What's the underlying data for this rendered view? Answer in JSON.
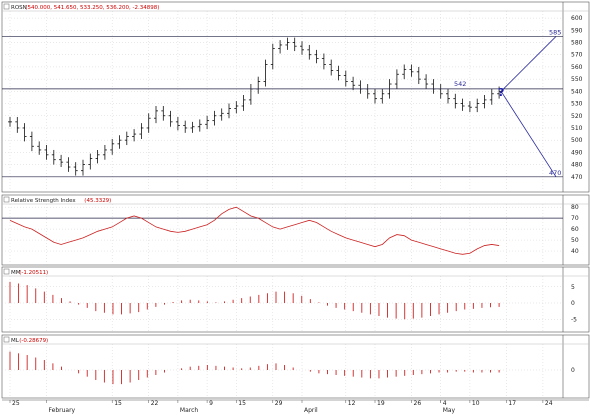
{
  "colors": {
    "price_bar": "#111111",
    "level_line": "#222244",
    "trend_line": "#2a2aa0",
    "indicator": "#cc2222",
    "grid": "#c8c8c8",
    "panel_border": "#555555"
  },
  "chart_data": [
    {
      "type": "ohlc",
      "title": "ROSN",
      "header_values": "(540.000, 541.650, 533.250, 536.200, -2.34898)",
      "ylim": [
        460,
        605
      ],
      "y_ticks": [
        470,
        480,
        490,
        500,
        510,
        520,
        530,
        540,
        550,
        560,
        570,
        580,
        590,
        600
      ],
      "grid": true,
      "x_ticks": [
        {
          "i": 0,
          "label": "25"
        },
        {
          "i": 5,
          "label": "February"
        },
        {
          "i": 14,
          "label": "15"
        },
        {
          "i": 19,
          "label": "22"
        },
        {
          "i": 23,
          "label": "March"
        },
        {
          "i": 27,
          "label": "9"
        },
        {
          "i": 31,
          "label": "15"
        },
        {
          "i": 36,
          "label": "29"
        },
        {
          "i": 40,
          "label": "April"
        },
        {
          "i": 46,
          "label": "12"
        },
        {
          "i": 50,
          "label": "19"
        },
        {
          "i": 55,
          "label": "26"
        },
        {
          "i": 59,
          "label": "4"
        },
        {
          "i": 59,
          "label": "May"
        },
        {
          "i": 63,
          "label": "10"
        },
        {
          "i": 68,
          "label": "17"
        },
        {
          "i": 73,
          "label": "24"
        }
      ],
      "close": [
        515,
        510,
        503,
        495,
        492,
        488,
        484,
        482,
        478,
        475,
        480,
        485,
        488,
        492,
        497,
        500,
        503,
        505,
        510,
        518,
        524,
        520,
        515,
        512,
        510,
        511,
        513,
        516,
        520,
        522,
        526,
        528,
        533,
        542,
        548,
        562,
        575,
        578,
        580,
        577,
        574,
        570,
        567,
        562,
        557,
        553,
        548,
        545,
        542,
        538,
        534,
        538,
        546,
        554,
        558,
        556,
        550,
        546,
        542,
        538,
        534,
        530,
        528,
        527,
        530,
        533,
        538,
        540
      ],
      "levels": [
        {
          "label": "585",
          "value": 585
        },
        {
          "label": "542",
          "value": 542
        },
        {
          "label": "470",
          "value": 470
        }
      ],
      "annotations": [
        "585",
        "542",
        "470",
        "?"
      ]
    },
    {
      "type": "line",
      "title": "Relative Strength Index",
      "header_values": "(45.3329)",
      "ylim": [
        30,
        82
      ],
      "y_ticks": [
        40,
        50,
        60,
        70,
        80
      ],
      "levels": [
        70
      ],
      "values": [
        68,
        65,
        62,
        60,
        56,
        52,
        48,
        46,
        48,
        50,
        52,
        55,
        58,
        60,
        62,
        66,
        70,
        72,
        70,
        66,
        62,
        60,
        58,
        57,
        58,
        60,
        62,
        64,
        68,
        74,
        78,
        80,
        76,
        72,
        70,
        66,
        62,
        60,
        62,
        64,
        66,
        68,
        66,
        62,
        58,
        55,
        52,
        50,
        48,
        46,
        44,
        46,
        52,
        55,
        54,
        50,
        48,
        46,
        44,
        42,
        40,
        38,
        37,
        38,
        42,
        45,
        46,
        45
      ]
    },
    {
      "type": "bar",
      "title": "MM",
      "header_values": "(-1.20511)",
      "ylim": [
        -8,
        8
      ],
      "y_ticks": [
        -5,
        0,
        5
      ],
      "values": [
        6.5,
        6,
        5.5,
        4.5,
        3.5,
        2.5,
        1.5,
        0.5,
        -0.5,
        -1.5,
        -2.5,
        -3,
        -3.5,
        -3.5,
        -3.2,
        -2.8,
        -2,
        -1.2,
        -0.5,
        0.3,
        0.8,
        1,
        0.8,
        0.5,
        0.2,
        0.5,
        1,
        1.5,
        2,
        2.5,
        3,
        3.5,
        3.5,
        3,
        2.2,
        1.2,
        0.2,
        -0.8,
        -1.5,
        -2,
        -2.5,
        -3,
        -3.5,
        -4,
        -4.5,
        -4.8,
        -5,
        -4.8,
        -4.5,
        -4,
        -3.5,
        -3,
        -2.5,
        -2,
        -1.8,
        -1.5,
        -1.3,
        -1.2
      ]
    },
    {
      "type": "bar",
      "title": "ML",
      "header_values": "(-0.28679)",
      "ylim": [
        -3,
        3
      ],
      "y_ticks": [
        0
      ],
      "values": [
        2.2,
        2,
        1.8,
        1.5,
        1.2,
        0.8,
        0.4,
        0,
        -0.4,
        -0.8,
        -1.2,
        -1.5,
        -1.7,
        -1.7,
        -1.5,
        -1.2,
        -0.9,
        -0.6,
        -0.3,
        0,
        0.2,
        0.4,
        0.5,
        0.6,
        0.5,
        0.4,
        0.3,
        0.2,
        0.3,
        0.5,
        0.7,
        0.8,
        0.6,
        0.3,
        0,
        -0.2,
        -0.4,
        -0.5,
        -0.6,
        -0.7,
        -0.8,
        -0.9,
        -1,
        -1,
        -0.9,
        -0.8,
        -0.7,
        -0.6,
        -0.5,
        -0.4,
        -0.3,
        -0.3,
        -0.2,
        -0.2,
        -0.3,
        -0.3,
        -0.3,
        -0.3
      ]
    }
  ]
}
